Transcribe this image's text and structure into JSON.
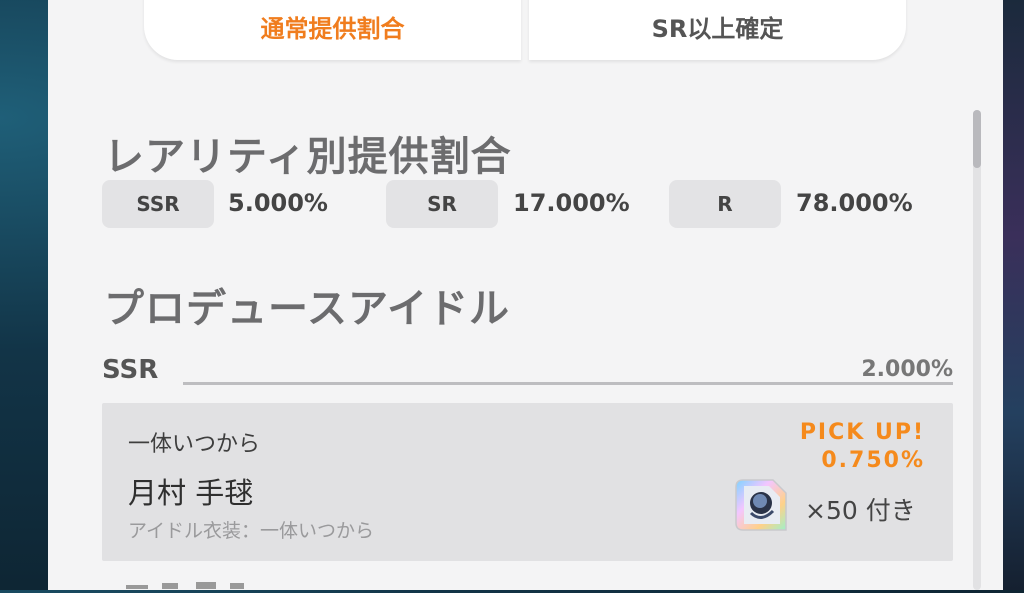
{
  "tabs": [
    {
      "label": "通常提供割合",
      "active": true
    },
    {
      "label": "SR以上確定",
      "active": false
    }
  ],
  "rarity_section": {
    "title": "レアリティ別提供割合",
    "rates": [
      {
        "label": "SSR",
        "value": "5.000%"
      },
      {
        "label": "SR",
        "value": "17.000%"
      },
      {
        "label": "R",
        "value": "78.000%"
      }
    ]
  },
  "idol_section": {
    "title": "プロデュースアイドル",
    "group": {
      "rarity": "SSR",
      "rate": "2.000%"
    },
    "card": {
      "subtitle": "一体いつから",
      "name": "月村 手毬",
      "costume": "アイドル衣装：一体いつから",
      "pickup_label": "PICK UP!",
      "pickup_rate": "0.750%",
      "item_count": "×50 付き",
      "item_icon": "costume-piece-icon"
    }
  },
  "colors": {
    "accent": "#f07d1e",
    "panel_bg": "#f4f4f5",
    "card_bg": "#e1e1e3"
  }
}
